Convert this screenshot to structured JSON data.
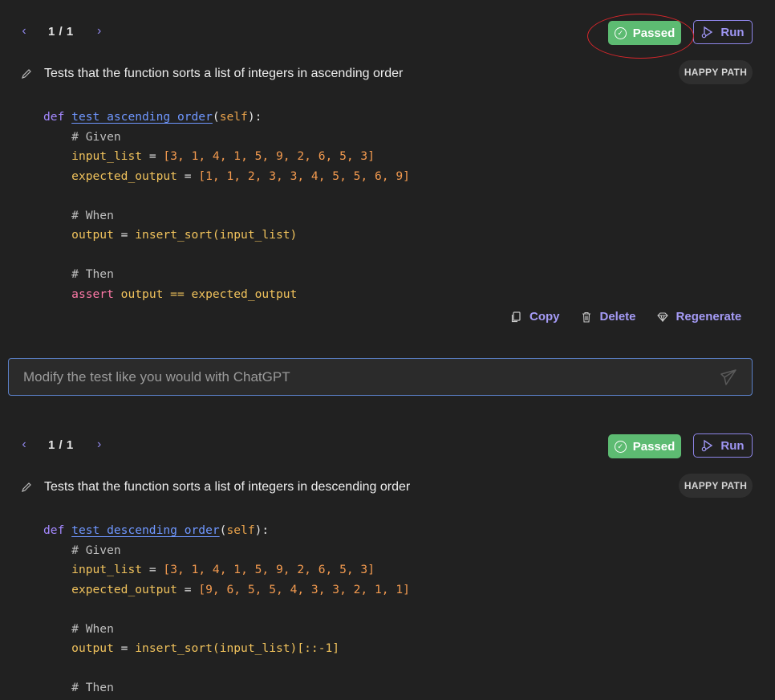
{
  "tests": [
    {
      "pager": "1 / 1",
      "status": "Passed",
      "run_label": "Run",
      "description": "Tests that the function sorts a list of integers in ascending order",
      "badge": "HAPPY PATH",
      "code": {
        "def": "def",
        "fn_name": "test_ascending_order",
        "self": "self",
        "given": "# Given",
        "input_list": "[3, 1, 4, 1, 5, 9, 2, 6, 5, 3]",
        "expected_output": "[1, 1, 2, 3, 3, 4, 5, 5, 6, 9]",
        "when": "# When",
        "call": "insert_sort(input_list)",
        "then": "# Then",
        "assert": "assert",
        "assert_expr": "output == expected_output"
      },
      "actions": {
        "copy": "Copy",
        "delete": "Delete",
        "regenerate": "Regenerate"
      },
      "prompt_placeholder": "Modify the test like you would with ChatGPT"
    },
    {
      "pager": "1 / 1",
      "status": "Passed",
      "run_label": "Run",
      "description": "Tests that the function sorts a list of integers in descending order",
      "badge": "HAPPY PATH",
      "code": {
        "def": "def",
        "fn_name": "test_descending_order",
        "self": "self",
        "given": "# Given",
        "input_list": "[3, 1, 4, 1, 5, 9, 2, 6, 5, 3]",
        "expected_output": "[9, 6, 5, 5, 4, 3, 3, 2, 1, 1]",
        "when": "# When",
        "call": "insert_sort(input_list)[::-1]",
        "then": "# Then"
      }
    }
  ],
  "colors": {
    "passed": "#5dbb72",
    "accent": "#8e85e8",
    "annotation": "#d7262b"
  }
}
